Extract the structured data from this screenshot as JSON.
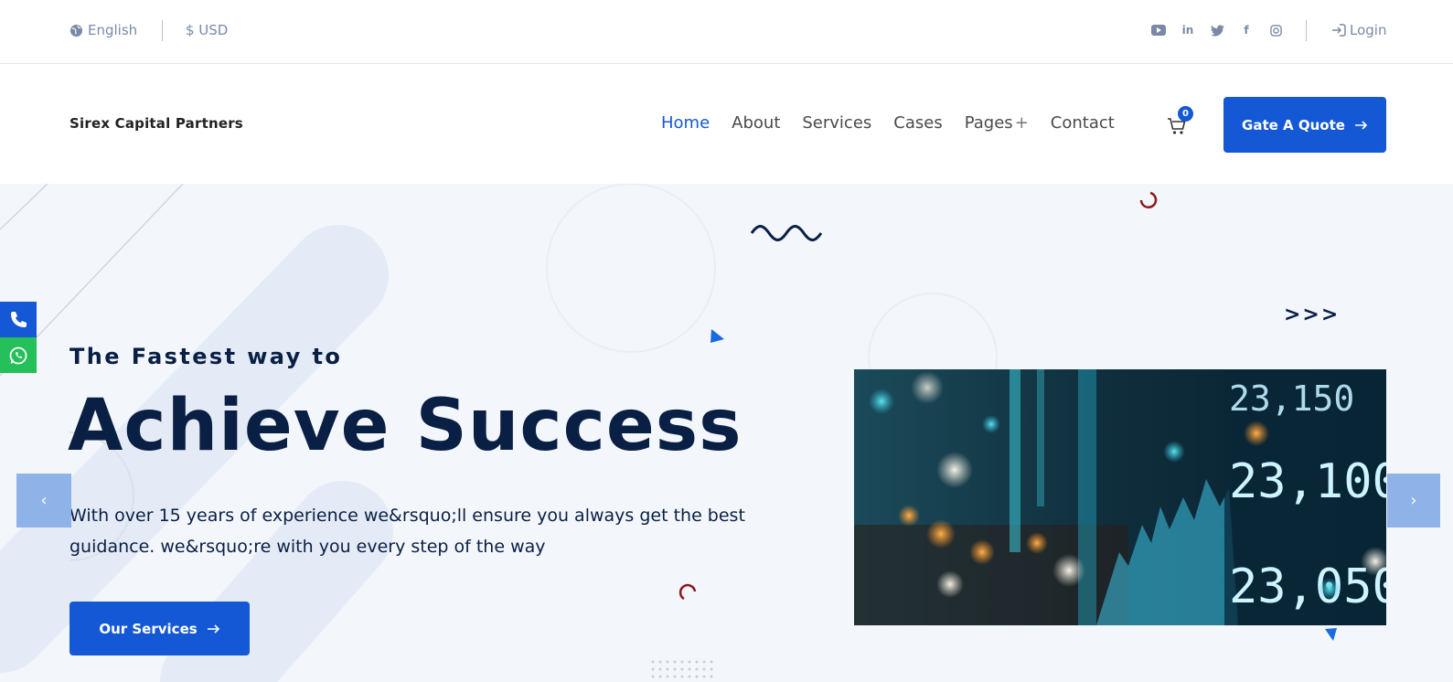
{
  "topbar": {
    "language": "English",
    "currency": "$ USD",
    "social": [
      "youtube-icon",
      "linkedin-icon",
      "twitter-icon",
      "facebook-icon",
      "instagram-icon"
    ],
    "login": "Login"
  },
  "header": {
    "logo": "Sirex Capital Partners",
    "nav": [
      {
        "label": "Home",
        "active": true
      },
      {
        "label": "About"
      },
      {
        "label": "Services"
      },
      {
        "label": "Cases"
      },
      {
        "label": "Pages"
      },
      {
        "label": "Contact"
      }
    ],
    "pages_plus": "+",
    "cart_count": "0",
    "quote_button": "Gate A Quote"
  },
  "hero": {
    "eyebrow": "The Fastest way to",
    "title": "Achieve Success",
    "description": "With over 15 years of experience we&rsquo;ll ensure you always get the best guidance. we&rsquo;re with you every step of the way",
    "button": "Our Services",
    "chevrons": ">>>",
    "prev": "‹",
    "next": "›"
  },
  "colors": {
    "accent": "#1558d6",
    "navy": "#0a1f44",
    "hero_bg": "#f3f7fc",
    "whatsapp": "#25c05a"
  }
}
